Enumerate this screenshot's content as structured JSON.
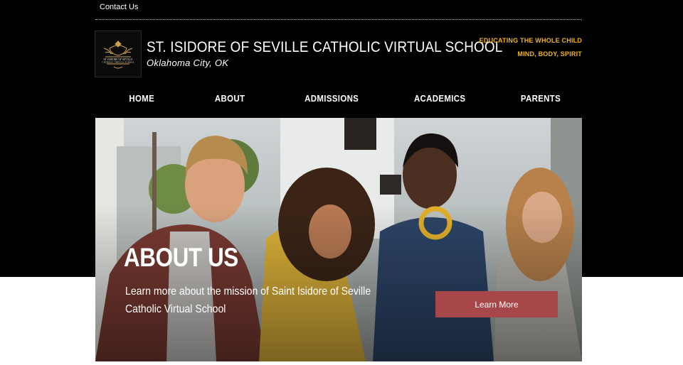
{
  "topbar": {
    "contact_label": "Contact Us"
  },
  "header": {
    "school_name": "ST. ISIDORE OF SEVILLE CATHOLIC VIRTUAL SCHOOL",
    "location": "Oklahoma City, OK",
    "tagline_line1": "EDUCATING THE WHOLE CHILD",
    "tagline_line2": "MIND, BODY, SPIRIT",
    "logo_text_line1": "ST. ISIDORE OF SEVILLE",
    "logo_text_line2": "CATHOLIC VIRTUAL SCHOOL"
  },
  "nav": {
    "items": [
      {
        "label": "HOME"
      },
      {
        "label": "ABOUT"
      },
      {
        "label": "ADMISSIONS"
      },
      {
        "label": "ACADEMICS"
      },
      {
        "label": "PARENTS"
      }
    ]
  },
  "hero": {
    "title": "ABOUT US",
    "description": "Learn more about the mission of Saint Isidore of Seville Catholic Virtual School",
    "button_label": "Learn More"
  },
  "colors": {
    "header_bg": "#000000",
    "tagline": "#f1b31c",
    "button_bg": "#a8474a",
    "text_light": "#ffffff"
  }
}
